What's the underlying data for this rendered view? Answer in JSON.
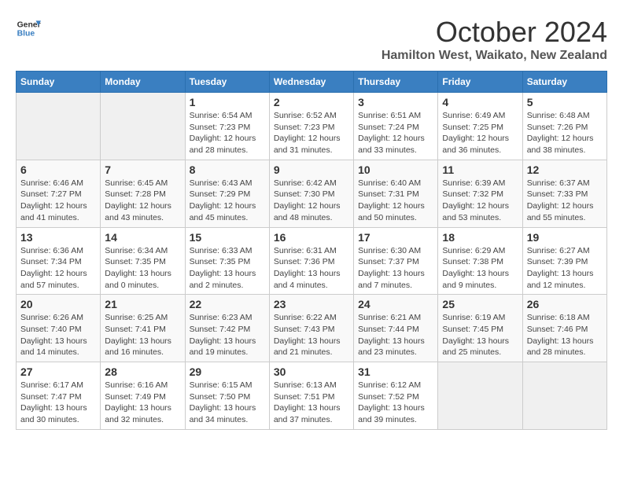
{
  "logo": {
    "line1": "General",
    "line2": "Blue"
  },
  "title": "October 2024",
  "location": "Hamilton West, Waikato, New Zealand",
  "weekdays": [
    "Sunday",
    "Monday",
    "Tuesday",
    "Wednesday",
    "Thursday",
    "Friday",
    "Saturday"
  ],
  "weeks": [
    [
      {
        "day": "",
        "sunrise": "",
        "sunset": "",
        "daylight": "",
        "empty": true
      },
      {
        "day": "",
        "sunrise": "",
        "sunset": "",
        "daylight": "",
        "empty": true
      },
      {
        "day": "1",
        "sunrise": "Sunrise: 6:54 AM",
        "sunset": "Sunset: 7:23 PM",
        "daylight": "Daylight: 12 hours and 28 minutes.",
        "empty": false
      },
      {
        "day": "2",
        "sunrise": "Sunrise: 6:52 AM",
        "sunset": "Sunset: 7:23 PM",
        "daylight": "Daylight: 12 hours and 31 minutes.",
        "empty": false
      },
      {
        "day": "3",
        "sunrise": "Sunrise: 6:51 AM",
        "sunset": "Sunset: 7:24 PM",
        "daylight": "Daylight: 12 hours and 33 minutes.",
        "empty": false
      },
      {
        "day": "4",
        "sunrise": "Sunrise: 6:49 AM",
        "sunset": "Sunset: 7:25 PM",
        "daylight": "Daylight: 12 hours and 36 minutes.",
        "empty": false
      },
      {
        "day": "5",
        "sunrise": "Sunrise: 6:48 AM",
        "sunset": "Sunset: 7:26 PM",
        "daylight": "Daylight: 12 hours and 38 minutes.",
        "empty": false
      }
    ],
    [
      {
        "day": "6",
        "sunrise": "Sunrise: 6:46 AM",
        "sunset": "Sunset: 7:27 PM",
        "daylight": "Daylight: 12 hours and 41 minutes.",
        "empty": false
      },
      {
        "day": "7",
        "sunrise": "Sunrise: 6:45 AM",
        "sunset": "Sunset: 7:28 PM",
        "daylight": "Daylight: 12 hours and 43 minutes.",
        "empty": false
      },
      {
        "day": "8",
        "sunrise": "Sunrise: 6:43 AM",
        "sunset": "Sunset: 7:29 PM",
        "daylight": "Daylight: 12 hours and 45 minutes.",
        "empty": false
      },
      {
        "day": "9",
        "sunrise": "Sunrise: 6:42 AM",
        "sunset": "Sunset: 7:30 PM",
        "daylight": "Daylight: 12 hours and 48 minutes.",
        "empty": false
      },
      {
        "day": "10",
        "sunrise": "Sunrise: 6:40 AM",
        "sunset": "Sunset: 7:31 PM",
        "daylight": "Daylight: 12 hours and 50 minutes.",
        "empty": false
      },
      {
        "day": "11",
        "sunrise": "Sunrise: 6:39 AM",
        "sunset": "Sunset: 7:32 PM",
        "daylight": "Daylight: 12 hours and 53 minutes.",
        "empty": false
      },
      {
        "day": "12",
        "sunrise": "Sunrise: 6:37 AM",
        "sunset": "Sunset: 7:33 PM",
        "daylight": "Daylight: 12 hours and 55 minutes.",
        "empty": false
      }
    ],
    [
      {
        "day": "13",
        "sunrise": "Sunrise: 6:36 AM",
        "sunset": "Sunset: 7:34 PM",
        "daylight": "Daylight: 12 hours and 57 minutes.",
        "empty": false
      },
      {
        "day": "14",
        "sunrise": "Sunrise: 6:34 AM",
        "sunset": "Sunset: 7:35 PM",
        "daylight": "Daylight: 13 hours and 0 minutes.",
        "empty": false
      },
      {
        "day": "15",
        "sunrise": "Sunrise: 6:33 AM",
        "sunset": "Sunset: 7:35 PM",
        "daylight": "Daylight: 13 hours and 2 minutes.",
        "empty": false
      },
      {
        "day": "16",
        "sunrise": "Sunrise: 6:31 AM",
        "sunset": "Sunset: 7:36 PM",
        "daylight": "Daylight: 13 hours and 4 minutes.",
        "empty": false
      },
      {
        "day": "17",
        "sunrise": "Sunrise: 6:30 AM",
        "sunset": "Sunset: 7:37 PM",
        "daylight": "Daylight: 13 hours and 7 minutes.",
        "empty": false
      },
      {
        "day": "18",
        "sunrise": "Sunrise: 6:29 AM",
        "sunset": "Sunset: 7:38 PM",
        "daylight": "Daylight: 13 hours and 9 minutes.",
        "empty": false
      },
      {
        "day": "19",
        "sunrise": "Sunrise: 6:27 AM",
        "sunset": "Sunset: 7:39 PM",
        "daylight": "Daylight: 13 hours and 12 minutes.",
        "empty": false
      }
    ],
    [
      {
        "day": "20",
        "sunrise": "Sunrise: 6:26 AM",
        "sunset": "Sunset: 7:40 PM",
        "daylight": "Daylight: 13 hours and 14 minutes.",
        "empty": false
      },
      {
        "day": "21",
        "sunrise": "Sunrise: 6:25 AM",
        "sunset": "Sunset: 7:41 PM",
        "daylight": "Daylight: 13 hours and 16 minutes.",
        "empty": false
      },
      {
        "day": "22",
        "sunrise": "Sunrise: 6:23 AM",
        "sunset": "Sunset: 7:42 PM",
        "daylight": "Daylight: 13 hours and 19 minutes.",
        "empty": false
      },
      {
        "day": "23",
        "sunrise": "Sunrise: 6:22 AM",
        "sunset": "Sunset: 7:43 PM",
        "daylight": "Daylight: 13 hours and 21 minutes.",
        "empty": false
      },
      {
        "day": "24",
        "sunrise": "Sunrise: 6:21 AM",
        "sunset": "Sunset: 7:44 PM",
        "daylight": "Daylight: 13 hours and 23 minutes.",
        "empty": false
      },
      {
        "day": "25",
        "sunrise": "Sunrise: 6:19 AM",
        "sunset": "Sunset: 7:45 PM",
        "daylight": "Daylight: 13 hours and 25 minutes.",
        "empty": false
      },
      {
        "day": "26",
        "sunrise": "Sunrise: 6:18 AM",
        "sunset": "Sunset: 7:46 PM",
        "daylight": "Daylight: 13 hours and 28 minutes.",
        "empty": false
      }
    ],
    [
      {
        "day": "27",
        "sunrise": "Sunrise: 6:17 AM",
        "sunset": "Sunset: 7:47 PM",
        "daylight": "Daylight: 13 hours and 30 minutes.",
        "empty": false
      },
      {
        "day": "28",
        "sunrise": "Sunrise: 6:16 AM",
        "sunset": "Sunset: 7:49 PM",
        "daylight": "Daylight: 13 hours and 32 minutes.",
        "empty": false
      },
      {
        "day": "29",
        "sunrise": "Sunrise: 6:15 AM",
        "sunset": "Sunset: 7:50 PM",
        "daylight": "Daylight: 13 hours and 34 minutes.",
        "empty": false
      },
      {
        "day": "30",
        "sunrise": "Sunrise: 6:13 AM",
        "sunset": "Sunset: 7:51 PM",
        "daylight": "Daylight: 13 hours and 37 minutes.",
        "empty": false
      },
      {
        "day": "31",
        "sunrise": "Sunrise: 6:12 AM",
        "sunset": "Sunset: 7:52 PM",
        "daylight": "Daylight: 13 hours and 39 minutes.",
        "empty": false
      },
      {
        "day": "",
        "sunrise": "",
        "sunset": "",
        "daylight": "",
        "empty": true
      },
      {
        "day": "",
        "sunrise": "",
        "sunset": "",
        "daylight": "",
        "empty": true
      }
    ]
  ]
}
